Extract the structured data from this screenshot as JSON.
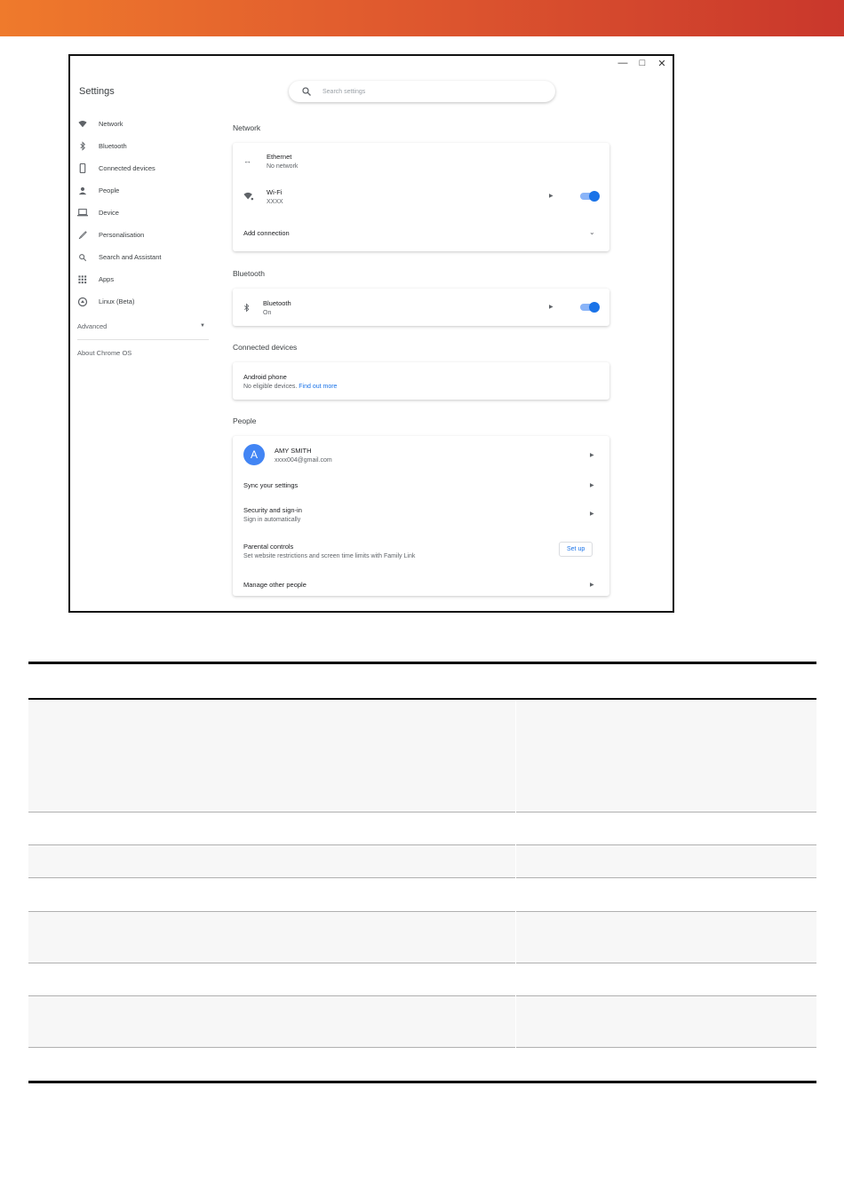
{
  "window": {
    "title": "Settings",
    "controls": [
      "minimize",
      "maximize",
      "close"
    ]
  },
  "search": {
    "placeholder": "Search settings"
  },
  "sidebar": {
    "items": [
      {
        "label": "Network",
        "icon": "wifi-icon"
      },
      {
        "label": "Bluetooth",
        "icon": "bluetooth-icon"
      },
      {
        "label": "Connected devices",
        "icon": "phone-icon"
      },
      {
        "label": "People",
        "icon": "person-icon"
      },
      {
        "label": "Device",
        "icon": "laptop-icon"
      },
      {
        "label": "Personalisation",
        "icon": "brush-icon"
      },
      {
        "label": "Search and Assistant",
        "icon": "search-icon"
      },
      {
        "label": "Apps",
        "icon": "apps-grid-icon"
      },
      {
        "label": "Linux (Beta)",
        "icon": "linux-icon"
      }
    ],
    "advanced": "Advanced",
    "about": "About Chrome OS"
  },
  "sections": {
    "network": {
      "title": "Network",
      "ethernet": {
        "name": "Ethernet",
        "status": "No network"
      },
      "wifi": {
        "name": "Wi-Fi",
        "status": "XXXX",
        "enabled": true
      },
      "add_connection": "Add connection"
    },
    "bluetooth": {
      "title": "Bluetooth",
      "item": {
        "name": "Bluetooth",
        "status": "On",
        "enabled": true
      }
    },
    "connected_devices": {
      "title": "Connected devices",
      "android": {
        "name": "Android phone",
        "status": "No eligible devices.",
        "link": "Find out more"
      }
    },
    "people": {
      "title": "People",
      "account": {
        "avatar_letter": "A",
        "name": "AMY SMITH",
        "email": "xxxx004@gmail.com"
      },
      "sync": "Sync your settings",
      "security": {
        "name": "Security and sign-in",
        "status": "Sign in automatically"
      },
      "parental": {
        "name": "Parental controls",
        "status": "Set website restrictions and screen time limits with Family Link",
        "button": "Set up"
      },
      "manage": "Manage other people"
    }
  },
  "colors": {
    "accent": "#1a73e8",
    "toggle_track": "#8ab4f8",
    "banner_start": "#ef7a2c",
    "banner_end": "#c9372c"
  }
}
